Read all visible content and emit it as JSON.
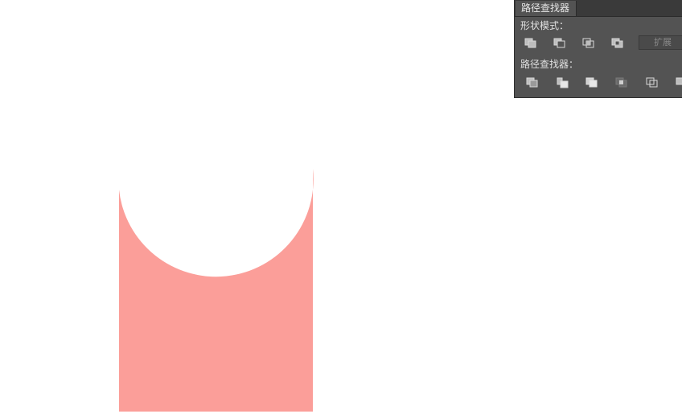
{
  "panel": {
    "tab_title": "路径查找器",
    "shape_modes_label": "形状模式：",
    "expand_label": "扩展",
    "pathfinders_label": "路径查找器："
  },
  "shape_modes": [
    {
      "name": "unite"
    },
    {
      "name": "minus-front"
    },
    {
      "name": "intersect"
    },
    {
      "name": "exclude"
    }
  ],
  "pathfinders": [
    {
      "name": "divide"
    },
    {
      "name": "trim"
    },
    {
      "name": "merge"
    },
    {
      "name": "crop"
    },
    {
      "name": "outline"
    },
    {
      "name": "minus-back"
    }
  ],
  "colors": {
    "shape_fill": "#fb9e99",
    "panel_bg": "#535353",
    "tab_bar": "#3a3a3a"
  }
}
